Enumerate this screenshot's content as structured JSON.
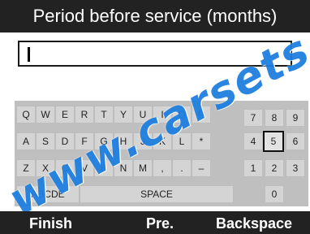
{
  "title": "Period before service (months)",
  "input": {
    "value": ""
  },
  "keyboard": {
    "rows": [
      [
        "Q",
        "W",
        "E",
        "R",
        "T",
        "Y",
        "U",
        "I",
        "O",
        "P"
      ],
      [
        "A",
        "S",
        "D",
        "F",
        "G",
        "H",
        "J",
        "K",
        "L",
        "*"
      ],
      [
        "Z",
        "X",
        "C",
        "V",
        "B",
        "N",
        "M",
        ",",
        ".",
        "–"
      ]
    ],
    "mode_key": "ABCDE",
    "space_key": "SPACE",
    "numpad": [
      [
        "7",
        "8",
        "9"
      ],
      [
        "4",
        "5",
        "6"
      ],
      [
        "1",
        "2",
        "3"
      ],
      [
        "0"
      ]
    ],
    "selected_key": "5"
  },
  "softkeys": {
    "left": "Finish",
    "center": "Pre.",
    "right": "Backspace"
  },
  "watermark": "www.carsets"
}
